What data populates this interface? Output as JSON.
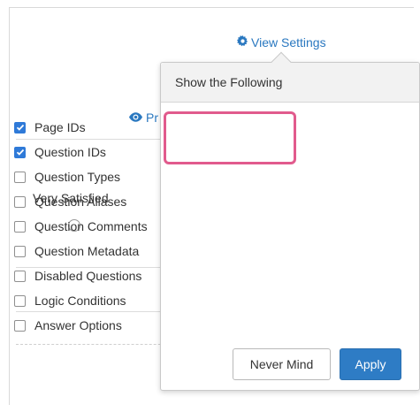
{
  "header": {
    "view_settings_label": "View Settings",
    "preview_label": "Pr"
  },
  "survey": {
    "column_label": "Very Satisfied"
  },
  "popover": {
    "title": "Show the Following",
    "options": [
      {
        "label": "Page IDs",
        "checked": true
      },
      {
        "label": "Question IDs",
        "checked": true
      },
      {
        "label": "Question Types",
        "checked": false
      },
      {
        "label": "Question Aliases",
        "checked": false
      },
      {
        "label": "Question Comments",
        "checked": false
      },
      {
        "label": "Question Metadata",
        "checked": false
      },
      {
        "label": "Disabled Questions",
        "checked": false
      },
      {
        "label": "Logic Conditions",
        "checked": false
      },
      {
        "label": "Answer Options",
        "checked": false
      }
    ],
    "never_mind_label": "Never Mind",
    "apply_label": "Apply"
  },
  "colors": {
    "link": "#2a78c0",
    "checkbox_checked": "#2f7ad8",
    "highlight": "#e15b8d",
    "apply_button": "#2e7cc5"
  },
  "icons": {
    "view_settings": "gear-icon",
    "preview": "eye-icon",
    "checked": "checkmark-icon"
  }
}
